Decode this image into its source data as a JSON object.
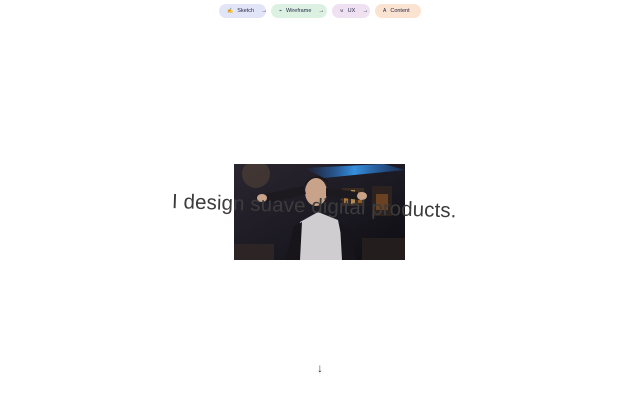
{
  "nav": {
    "pills": [
      {
        "label": "Sketch",
        "icon": "✍",
        "icon_name": "pen-icon",
        "arrow": "→",
        "color": "#e2e5f7"
      },
      {
        "label": "Wireframe",
        "icon": "⌁",
        "icon_name": "wireframe-icon",
        "arrow": "→",
        "color": "#dcf1e2"
      },
      {
        "label": "UX",
        "icon": "⊍",
        "icon_name": "ux-icon",
        "arrow": "→",
        "color": "#efe0f2"
      },
      {
        "label": "Content",
        "icon": "A",
        "icon_name": "text-icon",
        "color": "#fbe3d2"
      }
    ]
  },
  "hero": {
    "headline": "I design suave digital products.",
    "media_alt": "animated gif of a man dancing"
  },
  "scroll": {
    "icon": "↓",
    "icon_name": "arrow-down-icon"
  }
}
